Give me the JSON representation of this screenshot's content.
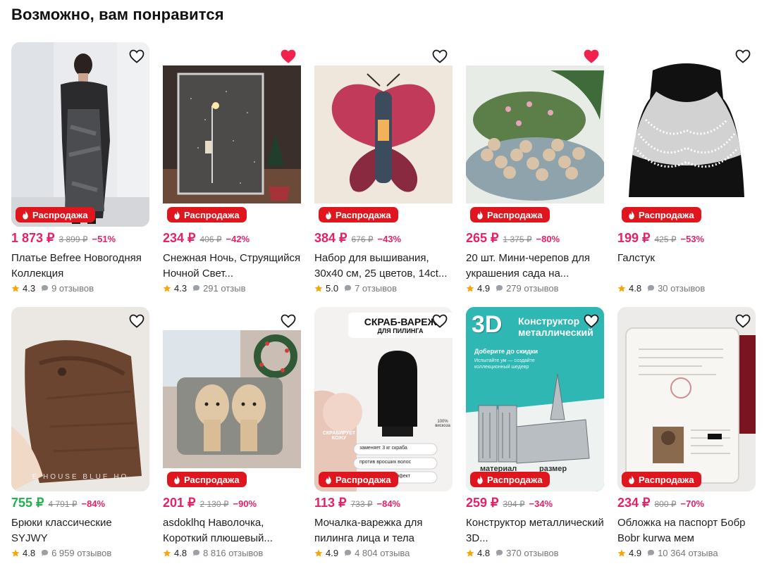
{
  "section_title": "Возможно, вам понравится",
  "badge_label": "Распродажа",
  "products": [
    {
      "name": "Платье Befree Новогодняя Коллекция",
      "price": "1 873 ₽",
      "old_price": "3 899 ₽",
      "discount": "−51%",
      "rating": "4.3",
      "reviews": "9 отзывов",
      "favorite": false,
      "price_color": "pink"
    },
    {
      "name": "Снежная Ночь, Струящийся Ночной Свет...",
      "price": "234 ₽",
      "old_price": "406 ₽",
      "discount": "−42%",
      "rating": "4.3",
      "reviews": "291 отзыв",
      "favorite": true,
      "price_color": "pink"
    },
    {
      "name": "Набор для вышивания, 30x40 см, 25 цветов, 14ct...",
      "price": "384 ₽",
      "old_price": "676 ₽",
      "discount": "−43%",
      "rating": "5.0",
      "reviews": "7 отзывов",
      "favorite": false,
      "price_color": "pink"
    },
    {
      "name": "20 шт. Мини-черепов для украшения сада на...",
      "price": "265 ₽",
      "old_price": "1 375 ₽",
      "discount": "−80%",
      "rating": "4.9",
      "reviews": "279 отзывов",
      "favorite": true,
      "price_color": "pink"
    },
    {
      "name": "Галстук",
      "price": "199 ₽",
      "old_price": "425 ₽",
      "discount": "−53%",
      "rating": "4.8",
      "reviews": "30 отзывов",
      "favorite": false,
      "price_color": "pink"
    },
    {
      "name": "Брюки классические SYJWY",
      "price": "755 ₽",
      "old_price": "4 791 ₽",
      "discount": "−84%",
      "rating": "4.8",
      "reviews": "6 959 отзывов",
      "favorite": false,
      "price_color": "green"
    },
    {
      "name": "asdoklhq Наволочка, Короткий плюшевый...",
      "price": "201 ₽",
      "old_price": "2 130 ₽",
      "discount": "−90%",
      "rating": "4.8",
      "reviews": "8 816 отзывов",
      "favorite": false,
      "price_color": "pink"
    },
    {
      "name": "Мочалка-варежка для пилинга лица и тела",
      "price": "113 ₽",
      "old_price": "733 ₽",
      "discount": "−84%",
      "rating": "4.9",
      "reviews": "4 804 отзыва",
      "favorite": false,
      "price_color": "pink"
    },
    {
      "name": "Конструктор металлический 3D...",
      "price": "259 ₽",
      "old_price": "394 ₽",
      "discount": "−34%",
      "rating": "4.8",
      "reviews": "370 отзывов",
      "favorite": false,
      "price_color": "pink"
    },
    {
      "name": "Обложка на паспорт Бобр Bobr kurwa мем",
      "price": "234 ₽",
      "old_price": "800 ₽",
      "discount": "−70%",
      "rating": "4.9",
      "reviews": "10 364 отзыва",
      "favorite": false,
      "price_color": "pink"
    }
  ],
  "image_texts": {
    "scrub_title": "СКРАБ-ВАРЕЖ",
    "scrub_sub": "ДЛЯ ПИЛИНГА",
    "scrub_note1": "СКРАБИРУЕТ КОЖУ",
    "scrub_note2": "заменяет 3 кг скраба",
    "scrub_note3": "против вросших волос",
    "scrub_note4": "целлюлитный эффект",
    "scrub_pct": "100% вискоза",
    "kit_3d": "3D",
    "kit_title1": "Конструктор",
    "kit_title2": "металлический",
    "kit_sub": "Доберите до скидки",
    "kit_small": "Испытайте ум — создайте коллекционный шедевр",
    "kit_mat": "материал",
    "kit_size": "размер",
    "pants_watermark": "E HOUSE BLUE HO"
  },
  "colors": {
    "accent": "#e4226a",
    "green": "#22b14c",
    "badge": "#e0161e",
    "star": "#f6a609",
    "heart_active": "#f3214e"
  },
  "icons": {
    "heart": "heart-icon",
    "badge": "fire-icon",
    "rating": "star-icon",
    "reviews": "chat-bubble-icon"
  }
}
